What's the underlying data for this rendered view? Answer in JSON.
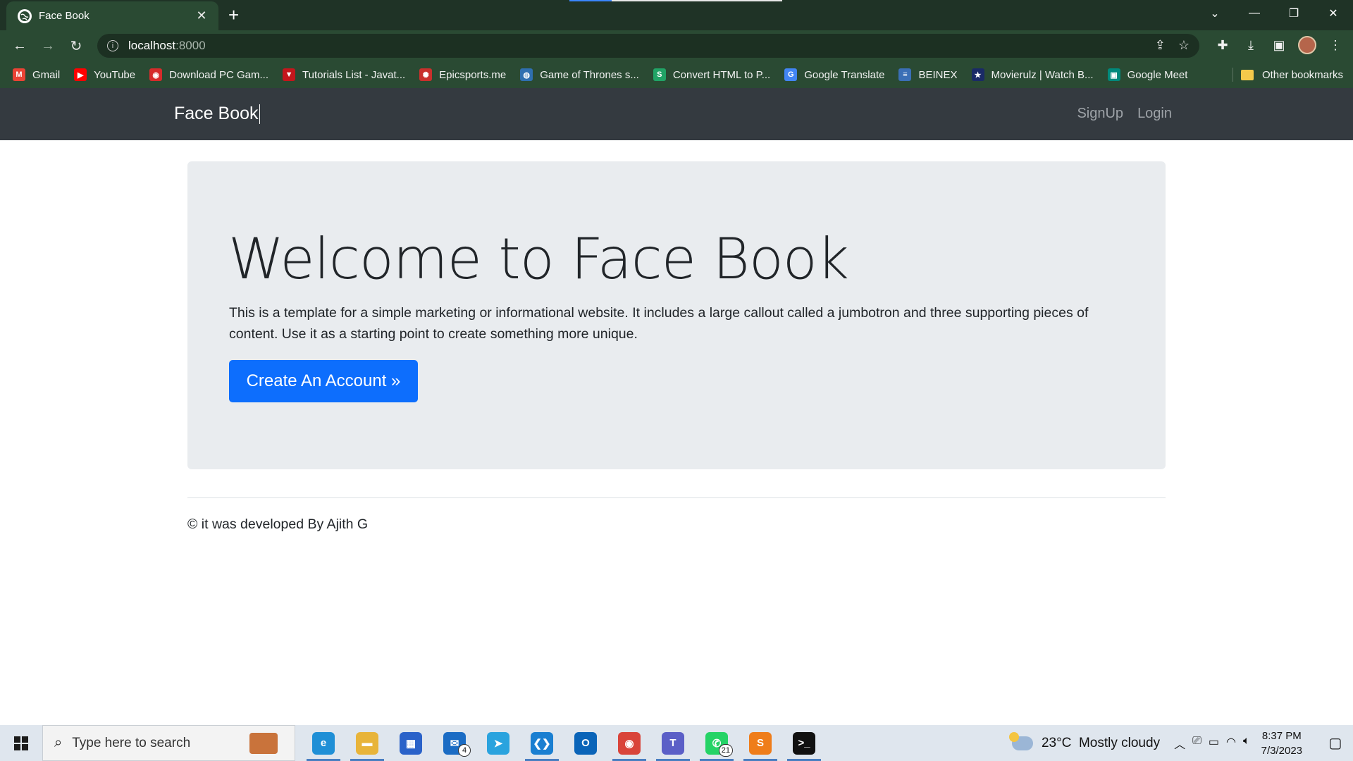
{
  "browser": {
    "tab_title": "Face Book",
    "url_host": "localhost",
    "url_port": ":8000",
    "bookmarks": [
      {
        "label": "Gmail",
        "icon": "gmail-icon",
        "color": "#ea4335",
        "glyph": "M"
      },
      {
        "label": "YouTube",
        "icon": "youtube-icon",
        "color": "#ff0000",
        "glyph": "▶"
      },
      {
        "label": "Download PC Gam...",
        "icon": "game-icon",
        "color": "#d62b2b",
        "glyph": "◉"
      },
      {
        "label": "Tutorials List - Javat...",
        "icon": "javatpoint-icon",
        "color": "#c4161c",
        "glyph": "▼"
      },
      {
        "label": "Epicsports.me",
        "icon": "epicsports-icon",
        "color": "#c9302c",
        "glyph": "✺"
      },
      {
        "label": "Game of Thrones s...",
        "icon": "globe-icon",
        "color": "#2f6fb0",
        "glyph": "◍"
      },
      {
        "label": "Convert HTML to P...",
        "icon": "convert-icon",
        "color": "#21a366",
        "glyph": "S"
      },
      {
        "label": "Google Translate",
        "icon": "translate-icon",
        "color": "#4285f4",
        "glyph": "G"
      },
      {
        "label": "BEINEX",
        "icon": "beinex-icon",
        "color": "#3b6fb6",
        "glyph": "≡"
      },
      {
        "label": "Movierulz | Watch B...",
        "icon": "movierulz-icon",
        "color": "#1a2a66",
        "glyph": "★"
      },
      {
        "label": "Google Meet",
        "icon": "meet-icon",
        "color": "#00897b",
        "glyph": "▣"
      }
    ],
    "other_bookmarks": "Other bookmarks"
  },
  "page": {
    "brand": "Face Book",
    "nav": {
      "signup": "SignUp",
      "login": "Login"
    },
    "jumbotron": {
      "heading": "Welcome to Face Book",
      "lead": "This is a template for a simple marketing or informational website. It includes a large callout called a jumbotron and three supporting pieces of content. Use it as a starting point to create something more unique.",
      "cta": "Create An Account »"
    },
    "footer": "© it was developed By Ajith G"
  },
  "taskbar": {
    "search_placeholder": "Type here to search",
    "apps": [
      {
        "name": "edge",
        "color": "#1f8fd6",
        "glyph": "e",
        "active": true
      },
      {
        "name": "file-explorer",
        "color": "#e8b43a",
        "glyph": "▬",
        "active": true
      },
      {
        "name": "microsoft-store",
        "color": "#2a62c9",
        "glyph": "▦",
        "active": false
      },
      {
        "name": "mail",
        "color": "#1b6cc4",
        "glyph": "✉",
        "active": false,
        "badge": "4"
      },
      {
        "name": "telegram",
        "color": "#2aa3de",
        "glyph": "➤",
        "active": false
      },
      {
        "name": "vscode",
        "color": "#1a7fd1",
        "glyph": "❮❯",
        "active": true
      },
      {
        "name": "outlook",
        "color": "#0a64b8",
        "glyph": "O",
        "active": false
      },
      {
        "name": "chrome",
        "color": "#d9443a",
        "glyph": "◉",
        "active": true
      },
      {
        "name": "teams",
        "color": "#5b5fc7",
        "glyph": "T",
        "active": true
      },
      {
        "name": "whatsapp",
        "color": "#25d366",
        "glyph": "✆",
        "active": true,
        "badge": "21"
      },
      {
        "name": "sublime-text",
        "color": "#ef7d1a",
        "glyph": "S",
        "active": true
      },
      {
        "name": "terminal",
        "color": "#111111",
        "glyph": ">_",
        "active": true
      }
    ],
    "weather": {
      "temp": "23°C",
      "desc": "Mostly cloudy"
    },
    "time": "8:37 PM",
    "date": "7/3/2023"
  },
  "colors": {
    "navbar_bg": "#343a40",
    "jumbotron_bg": "#e9ecef",
    "primary_button": "#0d6efd",
    "browser_frame": "#2a4a33"
  }
}
